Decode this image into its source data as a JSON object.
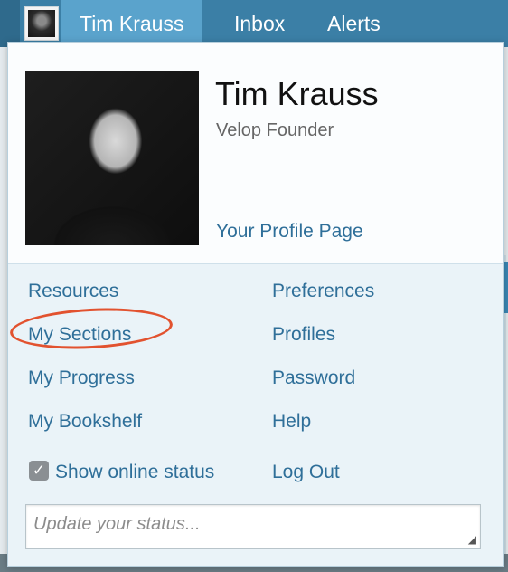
{
  "navbar": {
    "user_name": "Tim Krauss",
    "inbox": "Inbox",
    "alerts": "Alerts",
    "avatar_icon": "user-avatar-thumbnail"
  },
  "profile": {
    "name": "Tim Krauss",
    "role": "Velop Founder",
    "profile_link": "Your Profile Page"
  },
  "menu": {
    "left": [
      "Resources",
      "My Sections",
      "My Progress",
      "My Bookshelf"
    ],
    "right": [
      "Preferences",
      "Profiles",
      "Password",
      "Help",
      "Log Out"
    ],
    "highlighted_item": "My Sections"
  },
  "online_status": {
    "label": "Show online status",
    "checked": true
  },
  "status_input": {
    "placeholder": "Update your status...",
    "value": ""
  },
  "colors": {
    "navbar": "#3b7fa6",
    "navbar_active": "#5aa3cc",
    "link": "#2f6f99",
    "highlight": "#e2522f"
  }
}
